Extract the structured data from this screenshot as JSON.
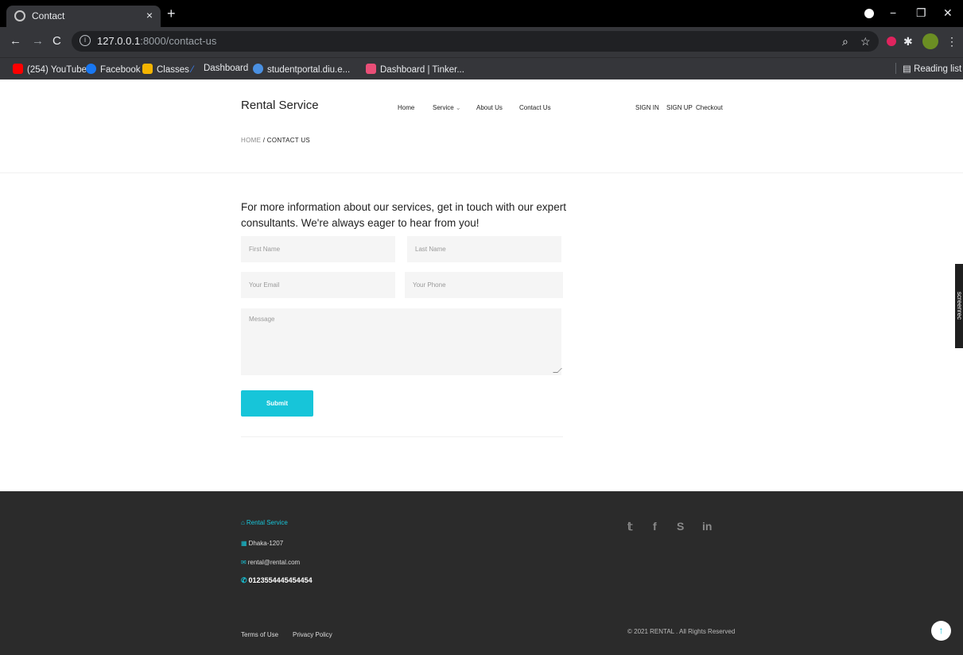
{
  "browser": {
    "tab_title": "Contact",
    "tab_close": "×",
    "new_tab": "+",
    "url_host": "127.0.0.1",
    "url_path": ":8000/contact-us",
    "window_controls": [
      "−",
      "❐",
      "✕"
    ],
    "bookmarks": [
      {
        "label": "(254) YouTube",
        "color": "#ff0000"
      },
      {
        "label": "Facebook",
        "color": "#1877f2"
      },
      {
        "label": "Classes",
        "color": "#f4b400"
      },
      {
        "label": "Dashboard",
        "color": "#3b82f6"
      },
      {
        "label": "studentportal.diu.e...",
        "color": "#4a90e2"
      },
      {
        "label": "Dashboard | Tinker...",
        "color": "#e94e77"
      }
    ],
    "reading_list": "Reading list"
  },
  "site": {
    "brand": "Rental Service",
    "nav": {
      "home": "Home",
      "service": "Service",
      "about": "About Us",
      "contact": "Contact Us"
    },
    "auth": {
      "sign_in": "SIGN IN",
      "sign_up": "SIGN UP",
      "checkout": "Checkout"
    },
    "breadcrumb": {
      "home": "HOME",
      "separator": "/",
      "current": "CONTACT US"
    }
  },
  "contact": {
    "intro": "For more information about our services, get in touch with our expert consultants. We're always eager to hear from you!",
    "first_name_placeholder": "First Name",
    "last_name_placeholder": "Last Name",
    "email_placeholder": "Your Email",
    "phone_placeholder": "Your Phone",
    "message_placeholder": "Message",
    "submit_label": "Submit"
  },
  "footer": {
    "brand": "Rental Service",
    "address": "Dhaka-1207",
    "email": "rental@rental.com",
    "phone": "0123554445454454",
    "social": [
      "twitter-icon",
      "facebook-icon",
      "skype-icon",
      "linkedin-icon"
    ],
    "terms": "Terms of Use",
    "privacy": "Privacy Policy",
    "copyright": "© 2021 RENTAL . All Rights Reserved"
  },
  "overlay": {
    "screenrec": "screenrec"
  },
  "colors": {
    "accent": "#17c5d9",
    "footer_bg": "#2b2b2b"
  }
}
